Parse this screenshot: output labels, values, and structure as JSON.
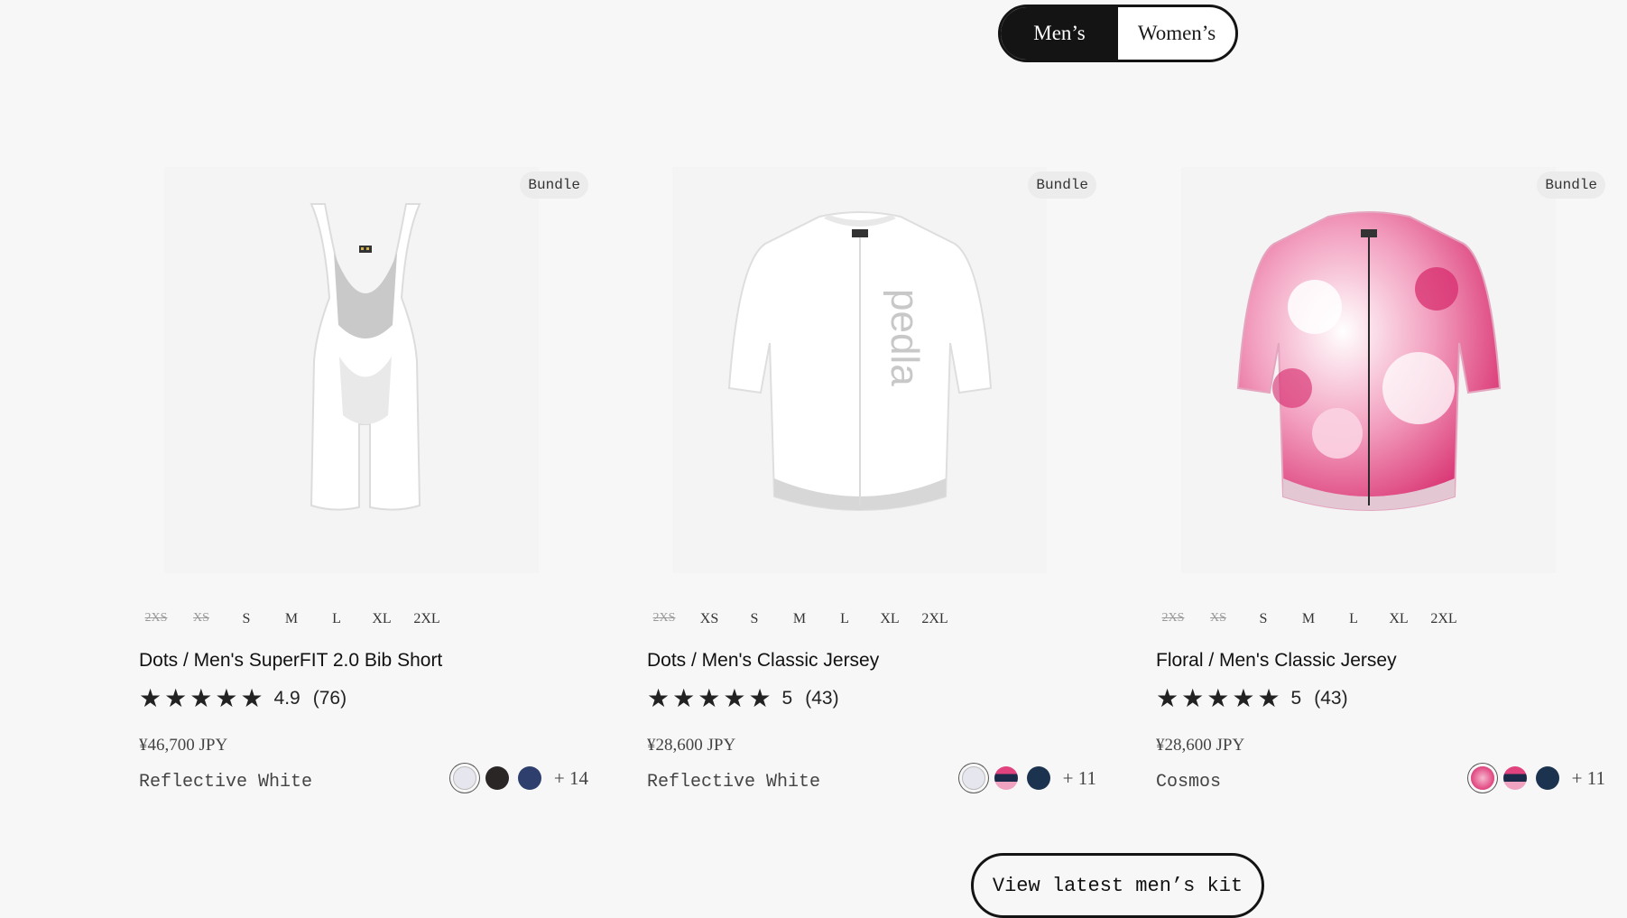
{
  "toggle": {
    "mens": "Men’s",
    "womens": "Women’s",
    "active": "mens"
  },
  "products": [
    {
      "badge": "Bundle",
      "sizes": [
        {
          "label": "2XS",
          "available": false
        },
        {
          "label": "XS",
          "available": false
        },
        {
          "label": "S",
          "available": true
        },
        {
          "label": "M",
          "available": true
        },
        {
          "label": "L",
          "available": true
        },
        {
          "label": "XL",
          "available": true
        },
        {
          "label": "2XL",
          "available": true
        }
      ],
      "name": "Dots / Men's SuperFIT 2.0 Bib Short",
      "stars": 5,
      "score": "4.9",
      "reviews": "(76)",
      "price": "¥46,700 JPY",
      "color_name": "Reflective White",
      "swatches": [
        "#e6e6ee",
        "#2a2626",
        "#2e3f6e"
      ],
      "more": "+ 14"
    },
    {
      "badge": "Bundle",
      "sizes": [
        {
          "label": "2XS",
          "available": false
        },
        {
          "label": "XS",
          "available": true
        },
        {
          "label": "S",
          "available": true
        },
        {
          "label": "M",
          "available": true
        },
        {
          "label": "L",
          "available": true
        },
        {
          "label": "XL",
          "available": true
        },
        {
          "label": "2XL",
          "available": true
        }
      ],
      "name": "Dots / Men's Classic Jersey",
      "stars": 5,
      "score": "5",
      "reviews": "(43)",
      "price": "¥28,600 JPY",
      "color_name": "Reflective White",
      "swatches": [
        "#e6e6ee",
        "striped",
        "#1c3350"
      ],
      "more": "+ 11"
    },
    {
      "badge": "Bundle",
      "sizes": [
        {
          "label": "2XS",
          "available": false
        },
        {
          "label": "XS",
          "available": false
        },
        {
          "label": "S",
          "available": true
        },
        {
          "label": "M",
          "available": true
        },
        {
          "label": "L",
          "available": true
        },
        {
          "label": "XL",
          "available": true
        },
        {
          "label": "2XL",
          "available": true
        }
      ],
      "name": "Floral / Men's Classic Jersey",
      "stars": 5,
      "score": "5",
      "reviews": "(43)",
      "price": "¥28,600 JPY",
      "color_name": "Cosmos",
      "swatches": [
        "#e0437e",
        "striped",
        "#1c3350"
      ],
      "more": "+ 11"
    }
  ],
  "cta": "View latest men’s kit",
  "colors": {
    "dark": "#141414",
    "background": "#f7f7f7",
    "star": "#222222"
  }
}
